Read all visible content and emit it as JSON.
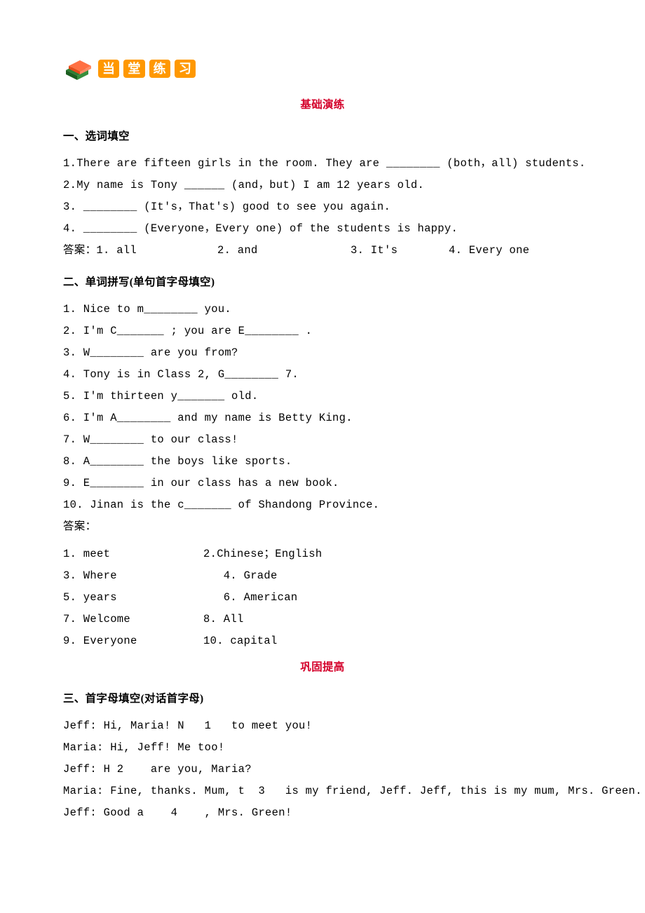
{
  "logo": {
    "c1": "当",
    "c2": "堂",
    "c3": "练",
    "c4": "习"
  },
  "head1": "基础演练",
  "sec1": {
    "title": "一、选词填空"
  },
  "q1": {
    "l1": "1.There are fifteen girls in the room. They are ________ (both，all) students.",
    "l2": "2.My name is Tony ______ (and，but) I am 12 years old.",
    "l3": "3. ________ (It's，That's) good to see you again.",
    "l4": "4. ________ (Everyone，Every one) of the students is happy."
  },
  "ans1": {
    "label": "答案：",
    "a1": "1. all",
    "a2": "2. and",
    "a3": "3. It's",
    "a4": "4. Every one"
  },
  "sec2": {
    "title": "二、单词拼写(单句首字母填空)"
  },
  "q2": {
    "l1": "1. Nice to m________ you.",
    "l2": "2. I'm C_______ ; you are E________ .",
    "l3": "3. W________ are you from?",
    "l4": "4. Tony is in Class 2, G________ 7.",
    "l5": "5. I'm thirteen y_______ old.",
    "l6": "6. I'm A________ and my name is Betty King.",
    "l7": "7. W________ to our class!",
    "l8": "8. A________ the boys like sports.",
    "l9": "9. E________ in our class has a new book.",
    "l10": "10. Jinan is the c_______ of Shandong Province."
  },
  "ans2label": "答案：",
  "ans2": {
    "r1a": "1. meet",
    "r1b": "2.Chinese；English",
    "r2a": "3. Where",
    "r2b": "   4. Grade",
    "r3a": "5. years",
    "r3b": "   6. American",
    "r4a": "7. Welcome",
    "r4b": "8. All",
    "r5a": "9. Everyone",
    "r5b": "10. capital"
  },
  "head2": "巩固提高",
  "sec3": {
    "title": "三、首字母填空(对话首字母)"
  },
  "dlg": {
    "l1": "Jeff: Hi, Maria! N   1   to meet you!",
    "l2": "Maria: Hi, Jeff! Me too!",
    "l3": "Jeff: H 2    are you, Maria?",
    "l4": "Maria: Fine, thanks. Mum, t  3   is my friend, Jeff. Jeff, this is my mum, Mrs. Green.",
    "l5": "Jeff: Good a    4    , Mrs. Green!"
  }
}
